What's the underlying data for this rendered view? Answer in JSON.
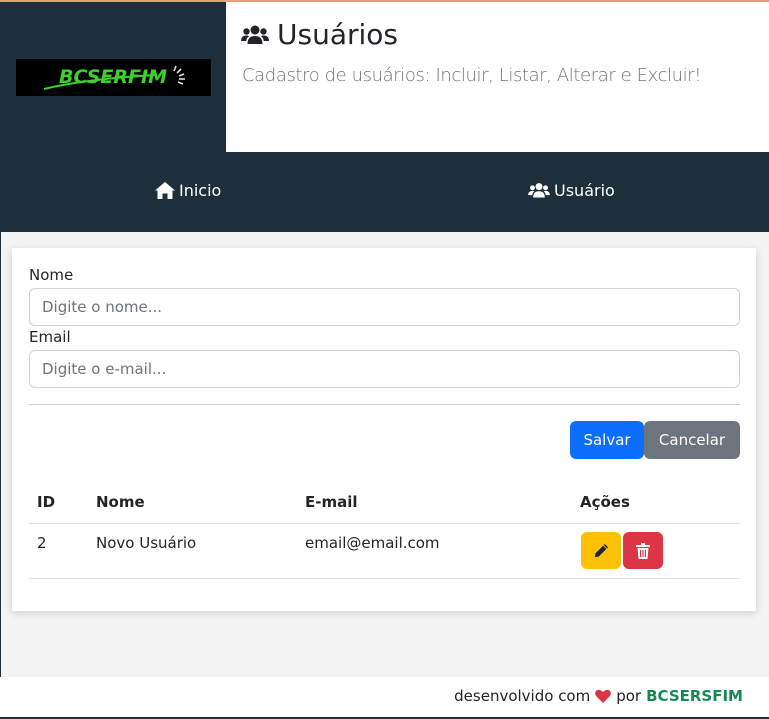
{
  "logo": {
    "text": "BCSERFIM"
  },
  "header": {
    "title": "Usuários",
    "subtitle": "Cadastro de usuários: Incluir, Listar, Alterar e Excluir!"
  },
  "nav": {
    "items": [
      {
        "label": "Inicio",
        "icon": "home-icon"
      },
      {
        "label": "Usuário",
        "icon": "users-icon"
      }
    ]
  },
  "form": {
    "name_label": "Nome",
    "name_placeholder": "Digite o nome...",
    "name_value": "",
    "email_label": "Email",
    "email_placeholder": "Digite o e-mail...",
    "email_value": "",
    "save_label": "Salvar",
    "cancel_label": "Cancelar"
  },
  "table": {
    "headers": [
      "ID",
      "Nome",
      "E-mail",
      "Ações"
    ],
    "rows": [
      {
        "id": "2",
        "name": "Novo Usuário",
        "email": "email@email.com"
      }
    ]
  },
  "footer": {
    "prefix": "desenvolvido com",
    "middle": "por",
    "brand": "BCSERSFIM"
  },
  "colors": {
    "dark": "#1d2f3a",
    "primary": "#0d6efd",
    "secondary": "#6c757d",
    "warning": "#ffc107",
    "danger": "#dc3545",
    "success": "#198754"
  }
}
